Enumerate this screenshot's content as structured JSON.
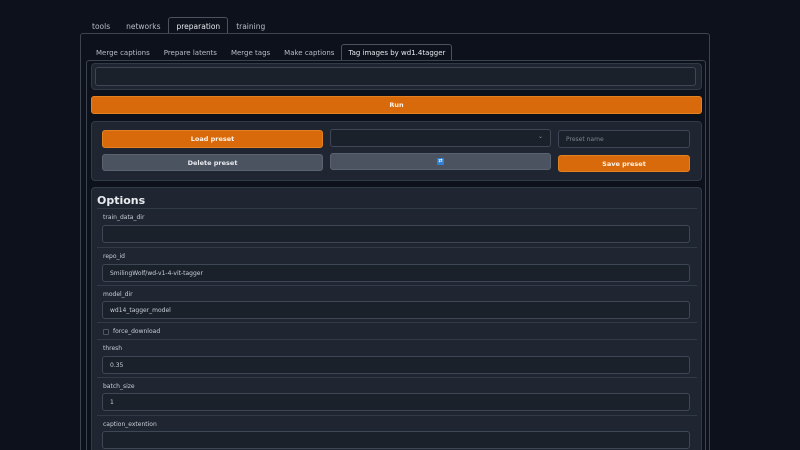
{
  "top_tabs": [
    "tools",
    "networks",
    "preparation",
    "training"
  ],
  "active_top_tab": "preparation",
  "sub_tabs": [
    "Merge captions",
    "Prepare latents",
    "Merge tags",
    "Make captions",
    "Tag images by wd1.4tagger"
  ],
  "active_sub_tab": "Tag images by wd1.4tagger",
  "run_label": "Run",
  "preset": {
    "load_label": "Load preset",
    "delete_label": "Delete preset",
    "save_label": "Save preset",
    "name_placeholder": "Preset name",
    "selected": ""
  },
  "options": {
    "title": "Options",
    "train_data_dir": {
      "label": "train_data_dir",
      "value": ""
    },
    "repo_id": {
      "label": "repo_id",
      "value": "SmilingWolf/wd-v1-4-vit-tagger"
    },
    "model_dir": {
      "label": "model_dir",
      "value": "wd14_tagger_model"
    },
    "force_download": {
      "label": "force_download",
      "checked": false
    },
    "thresh": {
      "label": "thresh",
      "value": "0.35"
    },
    "batch_size": {
      "label": "batch_size",
      "value": "1"
    },
    "caption_extention": {
      "label": "caption_extention",
      "value": ""
    }
  },
  "colors": {
    "background": "#0c111b",
    "panel": "#1f2631",
    "primary": "#d96a0b",
    "secondary": "#4b5361"
  },
  "icons": {
    "refresh": "refresh-icon",
    "dropdown": "chevron-down-icon"
  }
}
